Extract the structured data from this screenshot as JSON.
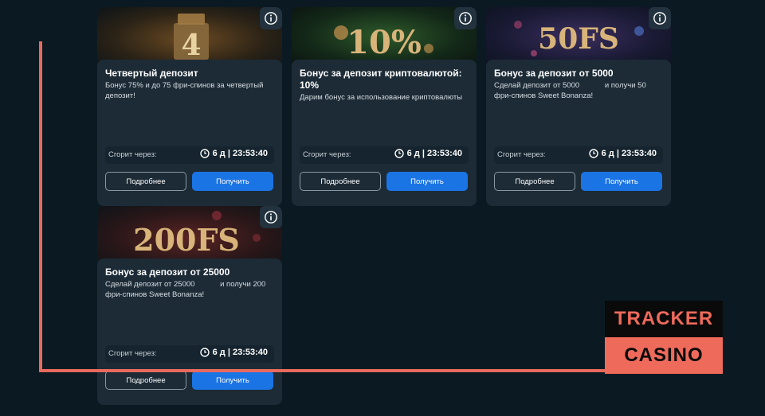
{
  "cards": [
    {
      "banner_text": "4",
      "title": "Четвертый депозит",
      "description": "Бонус 75% и до 75 фри-спинов за четвертый депозит!",
      "timer_label": "Сгорит через:",
      "timer_value": "6 д | 23:53:40",
      "more_label": "Подробнее",
      "get_label": "Получить"
    },
    {
      "banner_text": "10%",
      "title": "Бонус за депозит криптовалютой: 10%",
      "description": "Дарим бонус за использование криптовалюты",
      "timer_label": "Сгорит через:",
      "timer_value": "6 д | 23:53:40",
      "more_label": "Подробнее",
      "get_label": "Получить"
    },
    {
      "banner_text": "50FS",
      "title": "Бонус за депозит от 5000",
      "description": "Сделай депозит от 5000            и получи 50 фри-спинов Sweet Bonanza!",
      "timer_label": "Сгорит через:",
      "timer_value": "6 д | 23:53:40",
      "more_label": "Подробнее",
      "get_label": "Получить"
    },
    {
      "banner_text": "200FS",
      "title": "Бонус за депозит от 25000",
      "description": "Сделай депозит от 25000            и получи 200 фри-спинов Sweet Bonanza!",
      "timer_label": "Сгорит через:",
      "timer_value": "6 д | 23:53:40",
      "more_label": "Подробнее",
      "get_label": "Получить"
    }
  ],
  "watermark": {
    "top": "TRACKER",
    "bottom": "CASINO"
  },
  "colors": {
    "background": "#0b1a22",
    "card": "#1c2b36",
    "primary_button": "#1b74e4",
    "watermark_accent": "#ee6a5b"
  },
  "icons": {
    "info": "info-icon",
    "clock": "clock-icon"
  }
}
